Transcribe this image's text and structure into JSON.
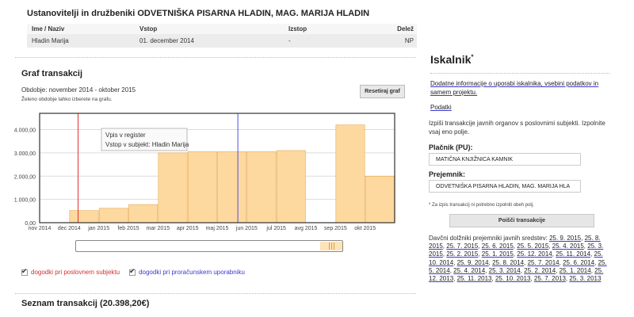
{
  "owners": {
    "title": "Ustanovitelji in družbeniki ODVETNIŠKA PISARNA HLADIN, MAG. MARIJA HLADIN",
    "headers": [
      "Ime / Naziv",
      "Vstop",
      "Izstop",
      "Delež"
    ],
    "rows": [
      [
        "Hladin Marija",
        "01. december 2014",
        "-",
        "NP"
      ]
    ]
  },
  "graph": {
    "title": "Graf transakcij",
    "period": "Obdobje: november 2014 - oktober 2015",
    "hint": "Želeno obdobje lahko izberete na grafu.",
    "reset_label": "Resetiraj graf",
    "tooltip_line1": "Vpis v register",
    "tooltip_line2": "Vstop v subjekt: Hladin Marija",
    "legend_red": "dogodki pri poslovnem subjektu",
    "legend_blue": "dogodki pri proračunskem uporabniku"
  },
  "chart_data": {
    "type": "bar",
    "categories": [
      "dec 2014",
      "jan 2015",
      "feb 2015",
      "mar 2015",
      "apr 2015",
      "maj 2015",
      "jun 2015",
      "jul 2015",
      "avg 2015",
      "sep 2015",
      "okt 2015"
    ],
    "x_tick_labels": [
      "nov 2014",
      "dec 2014",
      "jan 2015",
      "feb 2015",
      "mar 2015",
      "apr 2015",
      "maj 2015",
      "jun 2015",
      "jul 2015",
      "avg 2015",
      "sep 2015",
      "okt 2015"
    ],
    "values": [
      520,
      620,
      780,
      3000,
      3050,
      3050,
      3050,
      3100,
      0,
      4200,
      2000
    ],
    "ylim": [
      0,
      4700
    ],
    "y_ticks": [
      0,
      1000,
      2000,
      3000,
      4000
    ],
    "y_tick_labels": [
      "0,00",
      "1.000,00",
      "2.000,00",
      "3.000,00",
      "4.000,00"
    ],
    "grid": true,
    "bar_color": "#fdd9a0",
    "bar_border": "#e6a850",
    "event_lines": [
      {
        "date": "dec 2014",
        "color": "#e03030"
      },
      {
        "date": "maj 2015",
        "color": "#5050e0"
      }
    ]
  },
  "transactions": {
    "title": "Seznam transakcij (20.398,20€)"
  },
  "sidebar": {
    "title": "Iskalnik",
    "title_mark": "*",
    "info_link": "Dodatne informacije o uporabi iskalnika, vsebini podatkov in samem projektu.",
    "data_link": "Podatki",
    "description": "Izpiši transakcije javnih organov s poslovnimi subjekti. Izpolnite vsaj eno polje.",
    "payer_label": "Plačnik (PU):",
    "payer_value": "MATIČNA KNJIŽNICA KAMNIK",
    "recipient_label": "Prejemnik:",
    "recipient_value": "ODVETNIŠKA PISARNA HLADIN, MAG. MARIJA HLA",
    "note": "* Za izpis transakcij ni potrebno izpolniti obeh polj.",
    "search_label": "Poišči transakcije",
    "dates_intro": "Davčni dolžniki prejemniki javnih sredstev:",
    "dates": [
      "25. 9. 2015",
      "25. 8. 2015",
      "25. 7. 2015",
      "25. 6. 2015",
      "25. 5. 2015",
      "25. 4. 2015",
      "25. 3. 2015",
      "25. 2. 2015",
      "25. 1. 2015",
      "25. 12. 2014",
      "25. 11. 2014",
      "25. 10. 2014",
      "25. 9. 2014",
      "25. 8. 2014",
      "25. 7. 2014",
      "25. 6. 2014",
      "25. 5. 2014",
      "25. 4. 2014",
      "25. 3. 2014",
      "25. 2. 2014",
      "25. 1. 2014",
      "25. 12. 2013",
      "25. 11. 2013",
      "25. 10. 2013",
      "25. 7. 2013",
      "25. 3. 2013"
    ]
  }
}
